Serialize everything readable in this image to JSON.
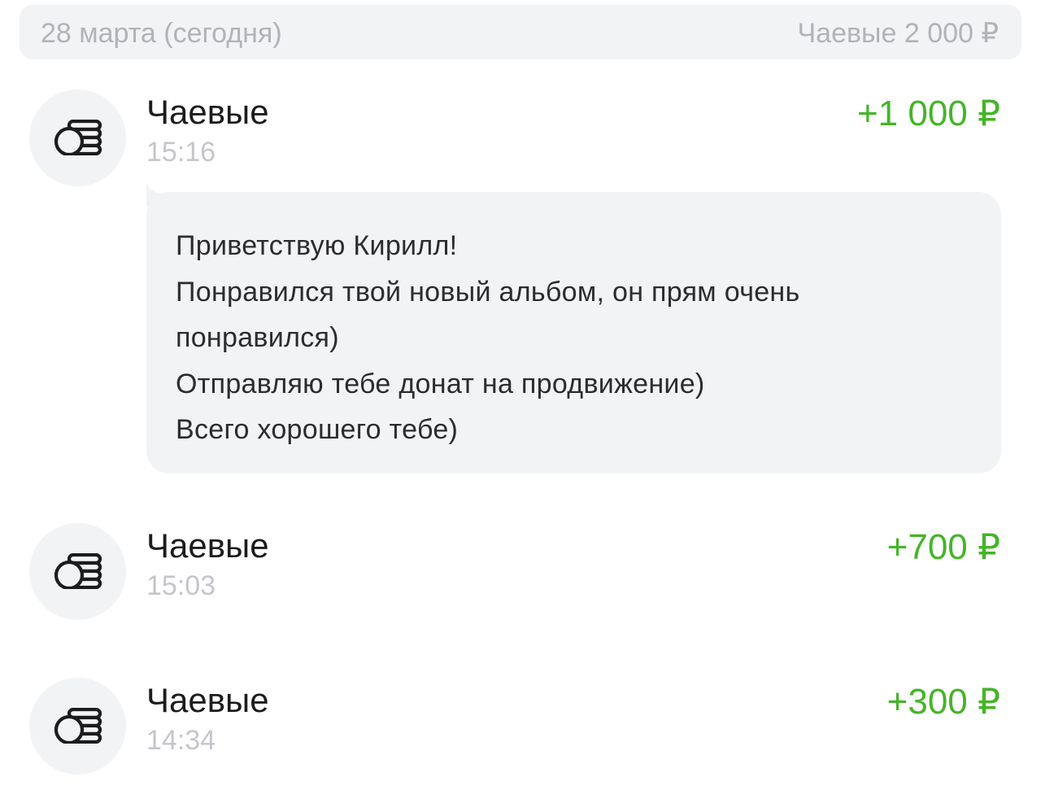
{
  "header": {
    "date": "28 марта (сегодня)",
    "total": "Чаевые 2 000 ₽"
  },
  "transactions": [
    {
      "title": "Чаевые",
      "time": "15:16",
      "amount": "+1 000 ₽",
      "icon": "coins-icon",
      "message": [
        "Приветствую Кирилл!",
        "Понравился твой новый альбом, он прям очень",
        "понравился)",
        "Отправляю тебе донат на продвижение)",
        "Всего хорошего тебе)"
      ]
    },
    {
      "title": "Чаевые",
      "time": "15:03",
      "amount": "+700 ₽",
      "icon": "coins-icon"
    },
    {
      "title": "Чаевые",
      "time": "14:34",
      "amount": "+300 ₽",
      "icon": "coins-icon"
    }
  ],
  "colors": {
    "amount_positive": "#44b527",
    "muted_text": "#b2b3b8",
    "surface": "#f2f3f5"
  }
}
